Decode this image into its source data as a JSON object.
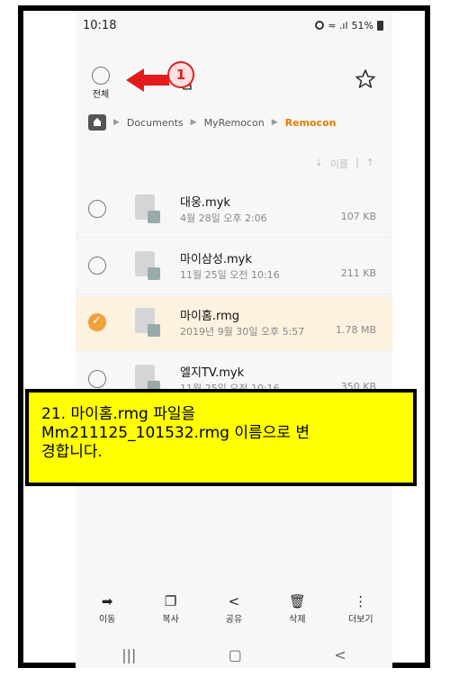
{
  "status": {
    "time": "10:18",
    "signal": "⊙ ≈ᴴᴰ.ıl",
    "battery": "51%"
  },
  "header": {
    "select_all_label": "전체",
    "title": "됨"
  },
  "annotation": {
    "step_number": "1"
  },
  "breadcrumb": {
    "items": [
      "Documents",
      "MyRemocon",
      "Remocon"
    ]
  },
  "sort": {
    "label": "이름",
    "arrow": "↑"
  },
  "files": [
    {
      "name": "대웅.myk",
      "date": "4월 28일 오후 2:06",
      "size": "107 KB",
      "selected": false
    },
    {
      "name": "마이삼성.myk",
      "date": "11월 25일 오전 10:16",
      "size": "211 KB",
      "selected": false
    },
    {
      "name": "마이홈.rmg",
      "date": "2019년 9월 30일 오후 5:57",
      "size": "1.78 MB",
      "selected": true
    },
    {
      "name": "엘지TV.myk",
      "date": "11월 25일 오전 10:16",
      "size": "350 KB",
      "selected": false
    }
  ],
  "callout": {
    "line1": "21.  마이홈.rmg 파일을",
    "line2": "Mm211125_101532.rmg  이름으로 변",
    "line3": "경합니다."
  },
  "toolbar": [
    {
      "icon": "move-icon",
      "label": "이동"
    },
    {
      "icon": "copy-icon",
      "label": "복사"
    },
    {
      "icon": "share-icon",
      "label": "공유"
    },
    {
      "icon": "delete-icon",
      "label": "삭제"
    },
    {
      "icon": "more-icon",
      "label": "더보기"
    }
  ],
  "colors": {
    "accent": "#e07f00",
    "selected_row": "#fdf1df",
    "callout_bg": "#ffff00",
    "badge": "#dd2222"
  }
}
